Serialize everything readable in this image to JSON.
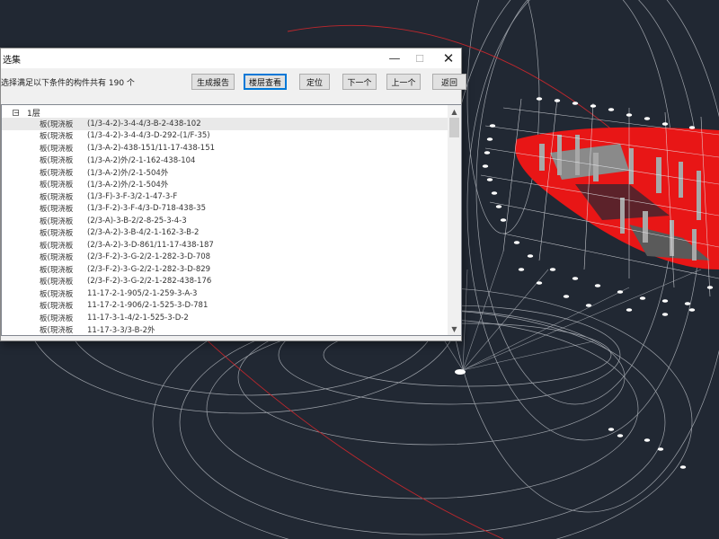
{
  "dialog": {
    "title": "选集",
    "summary": "选择满足以下条件的构件共有 190 个",
    "controls": {
      "minimize": "—",
      "maximize": "☐",
      "close": "✕"
    },
    "buttons": {
      "report": "生成报告",
      "layer_view": "楼层查看",
      "locate": "定位",
      "next": "下一个",
      "prev": "上一个",
      "back": "返回"
    },
    "tree": {
      "expander": "−",
      "root_label": "1层",
      "items": [
        {
          "type": "板(現浇板",
          "code": "(1/3-4-2)-3-4-4/3-B-2-438-102"
        },
        {
          "type": "板(現浇板",
          "code": "(1/3-4-2)-3-4-4/3-D-292-(1/F-35)"
        },
        {
          "type": "板(現浇板",
          "code": "(1/3-A-2)-438-151/11-17-438-151"
        },
        {
          "type": "板(現浇板",
          "code": "(1/3-A-2)外/2-1-162-438-104"
        },
        {
          "type": "板(現浇板",
          "code": "(1/3-A-2)外/2-1-504外"
        },
        {
          "type": "板(現浇板",
          "code": "(1/3-A-2)外/2-1-504外"
        },
        {
          "type": "板(現浇板",
          "code": "(1/3-F)-3-F-3/2-1-47-3-F"
        },
        {
          "type": "板(現浇板",
          "code": "(1/3-F-2)-3-F-4/3-D-718-438-35"
        },
        {
          "type": "板(現浇板",
          "code": "(2/3-A)-3-B-2/2-8-25-3-4-3"
        },
        {
          "type": "板(現浇板",
          "code": "(2/3-A-2)-3-B-4/2-1-162-3-B-2"
        },
        {
          "type": "板(現浇板",
          "code": "(2/3-A-2)-3-D-861/11-17-438-187"
        },
        {
          "type": "板(現浇板",
          "code": "(2/3-F-2)-3-G-2/2-1-282-3-D-708"
        },
        {
          "type": "板(現浇板",
          "code": "(2/3-F-2)-3-G-2/2-1-282-3-D-829"
        },
        {
          "type": "板(現浇板",
          "code": "(2/3-F-2)-3-G-2/2-1-282-438-176"
        },
        {
          "type": "板(現浇板",
          "code": "11-17-2-1-905/2-1-259-3-A-3"
        },
        {
          "type": "板(現浇板",
          "code": "11-17-2-1-906/2-1-525-3-D-781"
        },
        {
          "type": "板(現浇板",
          "code": "11-17-3-1-4/2-1-525-3-D-2"
        },
        {
          "type": "板(現浇板",
          "code": "11-17-3-3/3-B-2外"
        }
      ]
    },
    "scrollbar": {
      "up": "▲",
      "down": "▼"
    }
  },
  "viewport": {
    "background_color": "#212833",
    "line_color": "#c8ccd2",
    "accent_color": "#ff0000",
    "red_line_color": "#c0272d"
  }
}
